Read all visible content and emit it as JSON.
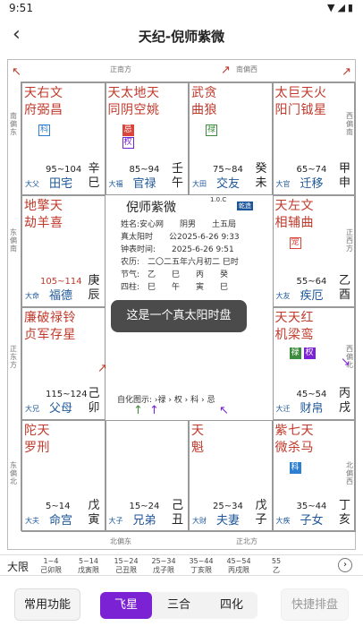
{
  "status": {
    "time": "9:51",
    "icons": "▼◢▮"
  },
  "nav": {
    "back": "‹",
    "title": "天纪-倪师紫微"
  },
  "directions": {
    "top_left": "正南方",
    "top_right": "南偏西",
    "left1": "南偏东",
    "left2": "东偏南",
    "left3": "正东方",
    "left4": "东偏北",
    "right1": "西偏南",
    "right2": "正西方",
    "right3": "西偏北",
    "right4": "北偏西",
    "bottom_left": "北偏东",
    "bottom_right": "正北方"
  },
  "palaces": [
    {
      "stars1": "天右文",
      "stars2": "府弼昌",
      "tags": [
        {
          "t": "科",
          "c": "#2c7fd1",
          "fill": false
        }
      ],
      "range": "95~104",
      "sub": "大父",
      "name": "田宅",
      "gz": "辛巳"
    },
    {
      "stars1": "天太地天",
      "stars2": "同阴空姚",
      "tags": [
        {
          "t": "忌",
          "c": "#d9443b",
          "fill": true
        },
        {
          "t": "权",
          "c": "#7b22d4",
          "fill": false
        }
      ],
      "range": "85~94",
      "sub": "大福",
      "name": "官禄",
      "gz": "壬午"
    },
    {
      "stars1": "武贪",
      "stars2": "曲狼",
      "tags": [
        {
          "t": "禄",
          "c": "#3d8b3d",
          "fill": false
        }
      ],
      "range": "75~84",
      "sub": "大田",
      "name": "交友",
      "gz": "癸未"
    },
    {
      "stars1": "太巨天火",
      "stars2": "阳门钺星",
      "tags": [],
      "range": "65~74",
      "sub": "大官",
      "name": "迁移",
      "gz": "甲申"
    },
    {
      "stars1": "地擎天",
      "stars2": "劫羊喜",
      "tags": [],
      "range": "105~114",
      "sub": "大命",
      "name": "福德",
      "gz": "庚辰",
      "hl": true
    },
    {
      "stars1": "天左文",
      "stars2": "相辅曲",
      "tags": [
        {
          "t": "宠",
          "c": "#d9443b",
          "fill": false
        }
      ],
      "range": "55~64",
      "sub": "大友",
      "name": "疾厄",
      "gz": "乙酉"
    },
    {
      "stars1": "廉破禄铃",
      "stars2": "贞军存星",
      "tags": [],
      "range": "115~124",
      "sub": "大兄",
      "name": "父母",
      "gz": "己卯"
    },
    {
      "stars1": "天天红",
      "stars2": "机梁鸾",
      "tags": [
        {
          "t": "禄",
          "c": "#3d8b3d",
          "fill": true
        },
        {
          "t": "权",
          "c": "#7b22d4",
          "fill": true
        }
      ],
      "range": "45~54",
      "sub": "大迁",
      "name": "财帛",
      "gz": "丙戌"
    },
    {
      "stars1": "陀天",
      "stars2": "罗刑",
      "tags": [],
      "range": "5~14",
      "sub": "大夫",
      "name": "命宫",
      "gz": "戊寅"
    },
    {
      "stars1": "",
      "stars2": "",
      "tags": [],
      "range": "15~24",
      "sub": "大子",
      "name": "兄弟",
      "gz": "己丑"
    },
    {
      "stars1": "天",
      "stars2": "魁",
      "tags": [],
      "range": "25~34",
      "sub": "大财",
      "name": "夫妻",
      "gz": "戊子"
    },
    {
      "stars1": "紫七天",
      "stars2": "微杀马",
      "tags": [
        {
          "t": "科",
          "c": "#2c7fd1",
          "fill": true
        }
      ],
      "range": "35~44",
      "sub": "大疾",
      "name": "子女",
      "gz": "丁亥"
    }
  ],
  "center": {
    "name": "倪师紫微",
    "name_tag": "1.0.C",
    "gender": "乾造",
    "rows": [
      "姓名:安心网　　阴男　　土五局",
      "真太阳时　　公2025-6-26 9:33",
      "钟表时间:　　2025-6-26 9:51",
      "农历:　二〇二五年六月初二 巳时",
      "节气:　乙　　巳　　丙　　癸",
      "四柱:　巳　　午　　寅　　巳"
    ],
    "sihua": "自化图示: ›禄 › 权 › 科 › 忌"
  },
  "toast": "这是一个真太阳时盘",
  "daxian": {
    "label": "大限",
    "items": [
      [
        "1~4",
        "己卯限"
      ],
      [
        "5~14",
        "戊寅限"
      ],
      [
        "15~24",
        "己丑限"
      ],
      [
        "25~34",
        "戊子限"
      ],
      [
        "35~44",
        "丁亥限"
      ],
      [
        "45~54",
        "丙戌限"
      ],
      [
        "55",
        "乙"
      ]
    ],
    "more": "›"
  },
  "bottom": {
    "common": "常用功能",
    "tabs": [
      "飞星",
      "三合",
      "四化"
    ],
    "active": 0,
    "quick": "快捷排盘"
  }
}
